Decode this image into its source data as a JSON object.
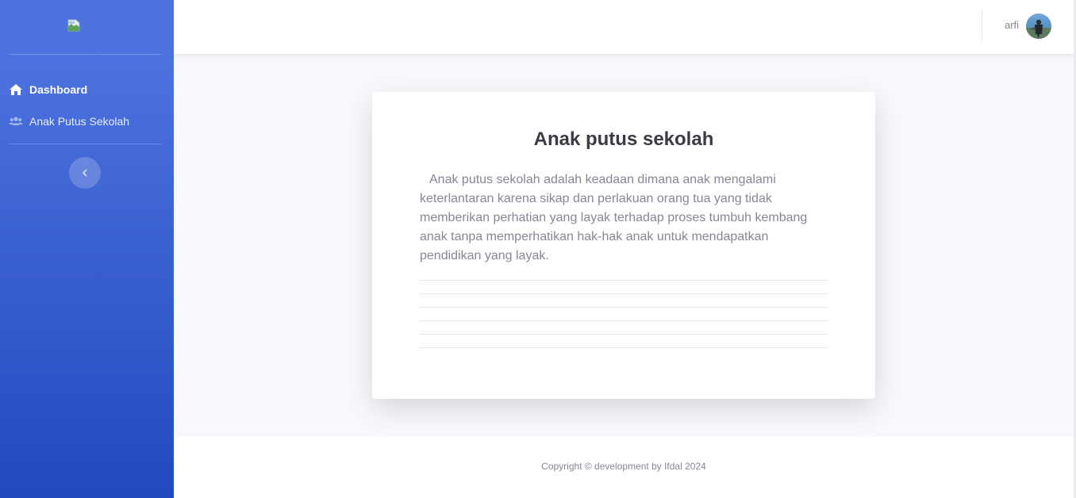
{
  "sidebar": {
    "brand_icon": "broken-image-icon",
    "items": [
      {
        "label": "Dashboard",
        "icon": "home-icon",
        "active": true
      },
      {
        "label": "Anak Putus Sekolah",
        "icon": "users-icon",
        "active": false
      }
    ],
    "toggle_icon": "chevron-left-icon",
    "gradient_top": "#4e73df",
    "gradient_bottom": "#224abe"
  },
  "topbar": {
    "user_name": "arfi",
    "avatar_icon": "user-avatar"
  },
  "card": {
    "title": "Anak putus sekolah",
    "body": "Anak putus sekolah adalah keadaan dimana anak mengalami keterlantaran karena sikap dan perlakuan orang tua yang tidak memberikan perhatian yang layak terhadap proses tumbuh kembang anak tanpa memperhatikan hak-hak anak untuk mendapatkan pendidikan yang layak."
  },
  "footer": {
    "copyright": "Copyright © development by Ifdal 2024"
  }
}
